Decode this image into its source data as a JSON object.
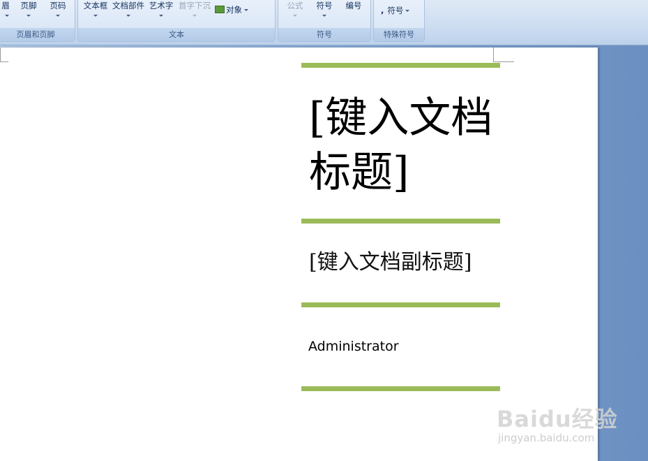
{
  "ribbon": {
    "header_footer_group": {
      "label": "页眉和页脚",
      "header_button": "眉",
      "footer_button": "页脚",
      "page_number_button": "页码"
    },
    "text_group": {
      "label": "文本",
      "textbox_button": "文本框",
      "quick_parts_button": "文档部件",
      "wordart_button": "艺术字",
      "dropcap_button": "首字下沉",
      "object_button": "对象"
    },
    "symbols_group": {
      "label": "符号",
      "equation_button": "公式",
      "symbol_button": "符号",
      "numbering_button": "编号"
    },
    "special_symbols_group": {
      "label": "特殊符号",
      "symbol_button": "符号",
      "symbol_glyph": ","
    }
  },
  "document": {
    "title": "[键入文档标题]",
    "subtitle": "[键入文档副标题]",
    "author": "Administrator"
  },
  "watermark": {
    "logo": "Baidu经验",
    "url": "jingyan.baidu.com"
  },
  "colors": {
    "accent_rule": "#9bbb59",
    "ribbon_bg": "#d6e4f5",
    "workspace_bg": "#8fb0d8"
  }
}
